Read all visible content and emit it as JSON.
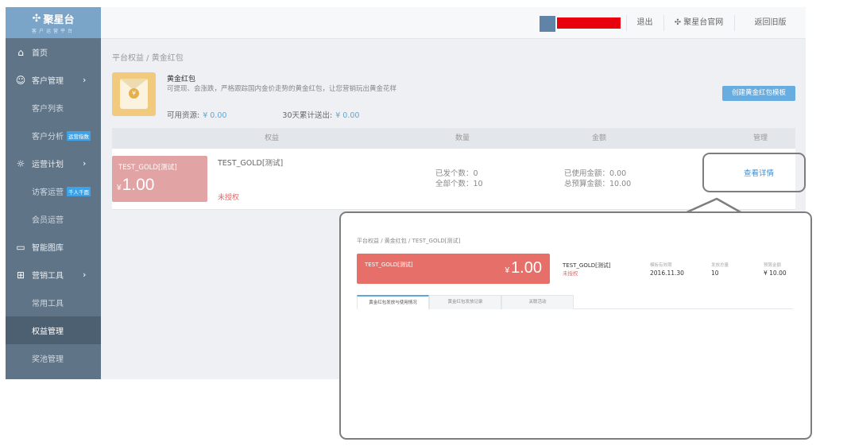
{
  "sidebar": {
    "logo": {
      "name": "聚星台",
      "tagline": "客户运营平台"
    },
    "items": [
      {
        "label": "首页",
        "icon": "home-icon"
      },
      {
        "label": "客户管理",
        "icon": "users-icon",
        "arrow": "›"
      },
      {
        "label": "客户列表"
      },
      {
        "label": "客户分析",
        "badge": "运营指数"
      },
      {
        "label": "运营计划",
        "icon": "sun-icon",
        "arrow": "›"
      },
      {
        "label": "访客运营",
        "badge": "千人千面"
      },
      {
        "label": "会员运营"
      },
      {
        "label": "智能图库",
        "icon": "image-icon"
      },
      {
        "label": "营销工具",
        "icon": "gift-icon",
        "arrow": "›"
      },
      {
        "label": "常用工具"
      },
      {
        "label": "权益管理"
      },
      {
        "label": "奖池管理"
      }
    ]
  },
  "topbar": {
    "username": "redacted-user",
    "logout": "退出",
    "official_site": "聚星台官网",
    "back_old": "返回旧版"
  },
  "main": {
    "breadcrumb": "平台权益 / 黄金红包",
    "intro_title": "黄金红包",
    "intro_desc": "可提现、会涨跌，严格跟踪国内金价走势的黄金红包，让您营销玩出黄金花样",
    "available_label": "可用资源:",
    "available_value": "¥ 0.00",
    "sent30_label": "30天累计送出:",
    "sent30_value": "¥ 0.00",
    "create_button": "创建黄金红包模板",
    "table_headers": [
      "权益",
      "数量",
      "金额",
      "管理"
    ],
    "row": {
      "card_name": "TEST_GOLD[测试]",
      "card_currency": "¥",
      "card_amount": "1.00",
      "name": "TEST_GOLD[测试]",
      "status": "未授权",
      "sent_count": "已发个数：0",
      "total_count": "全部个数：10",
      "used_amount": "已使用金额：0.00",
      "budget_amount": "总预算金额：10.00",
      "detail_link": "查看详情"
    }
  },
  "inset": {
    "breadcrumb": "平台权益 / 黄金红包 / TEST_GOLD[测试]",
    "card_name": "TEST_GOLD[测试]",
    "card_currency": "¥",
    "card_amount": "1.00",
    "name": "TEST_GOLD[测试]",
    "status": "未授权",
    "cols": [
      {
        "label": "模板有效期",
        "value": "2016.11.30"
      },
      {
        "label": "发放总量",
        "value": "10"
      },
      {
        "label": "预算金额",
        "value": "¥ 10.00"
      }
    ],
    "tabs": [
      "黄金红包发放与使用情况",
      "黄金红包发放记录",
      "关联活动"
    ]
  },
  "colors": {
    "sidebar_bg": "#5f7487",
    "logo_bg": "#7aa5c9",
    "accent": "#68ace0",
    "card_red": "#e67069",
    "card_pink": "#e2a3a4"
  }
}
